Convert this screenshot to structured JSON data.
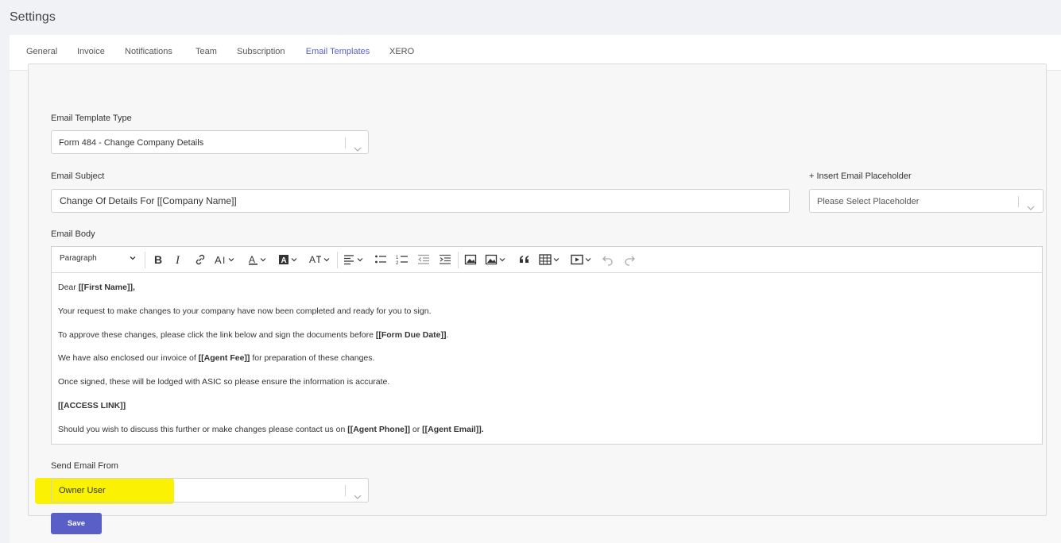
{
  "page": {
    "title": "Settings"
  },
  "tabs": [
    {
      "label": "General",
      "active": false
    },
    {
      "label": "Invoice",
      "active": false
    },
    {
      "label": "Notifications",
      "active": false
    },
    {
      "label": "Team",
      "active": false
    },
    {
      "label": "Subscription",
      "active": false
    },
    {
      "label": "Email Templates",
      "active": true
    },
    {
      "label": "XERO",
      "active": false
    }
  ],
  "form": {
    "template_type": {
      "label": "Email Template Type",
      "value": "Form 484 - Change Company Details"
    },
    "subject": {
      "label": "Email Subject",
      "value": "Change Of Details For [[Company Name]]"
    },
    "placeholder": {
      "label": "+ Insert Email Placeholder",
      "placeholder": "Please Select Placeholder"
    },
    "body": {
      "label": "Email Body",
      "paragraph_select": "Paragraph",
      "lines": [
        {
          "pre": "Dear ",
          "b1": "[[First Name]],",
          "mid": "",
          "b2": "",
          "post": ""
        },
        {
          "pre": "Your request to make changes to your company have now been completed and ready for you to sign.",
          "b1": "",
          "mid": "",
          "b2": "",
          "post": ""
        },
        {
          "pre": "To approve these changes, please click the link below and sign the documents before ",
          "b1": "[[Form Due Date]]",
          "mid": ".",
          "b2": "",
          "post": ""
        },
        {
          "pre": "We have also enclosed our invoice of ",
          "b1": "[[Agent Fee]]",
          "mid": " for preparation of these changes.",
          "b2": "",
          "post": ""
        },
        {
          "pre": "Once signed, these will be lodged with ASIC so please ensure the information is accurate.",
          "b1": "",
          "mid": "",
          "b2": "",
          "post": ""
        },
        {
          "pre": "",
          "b1": "[[ACCESS LINK]]",
          "mid": "",
          "b2": "",
          "post": ""
        },
        {
          "pre": "Should you wish to discuss this further or make changes please contact us on ",
          "b1": "[[Agent Phone]]",
          "mid": " or ",
          "b2": "[[Agent Email]].",
          "post": ""
        }
      ]
    },
    "send_from": {
      "label": "Send Email From",
      "value": "Owner User"
    },
    "save_label": "Save"
  },
  "colors": {
    "accent": "#5a5fc2",
    "highlight": "#fbf203",
    "save_button": "#5a5fc8"
  },
  "icons": [
    "chevron-down-icon",
    "bold-icon",
    "italic-icon",
    "link-icon",
    "font-size-icon",
    "font-color-icon",
    "highlight-icon",
    "clear-format-icon",
    "align-icon",
    "bulleted-list-icon",
    "numbered-list-icon",
    "outdent-icon",
    "indent-icon",
    "image-icon",
    "image-upload-icon",
    "quote-icon",
    "table-icon",
    "media-icon",
    "undo-icon",
    "redo-icon"
  ]
}
